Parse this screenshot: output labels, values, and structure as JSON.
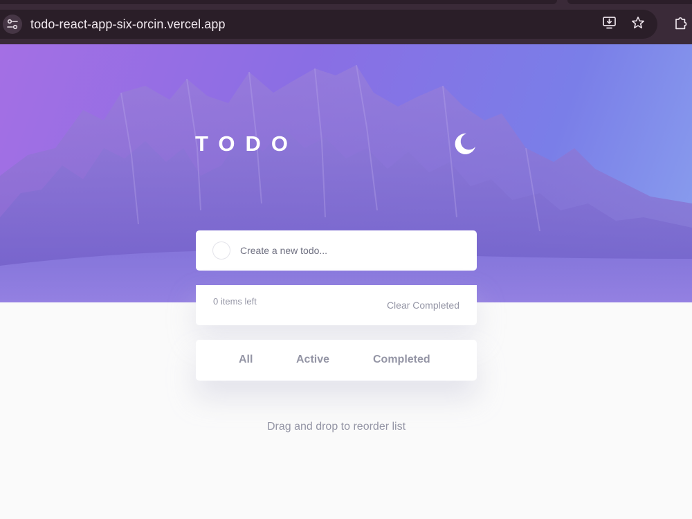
{
  "browser": {
    "url": "todo-react-app-six-orcin.vercel.app",
    "icons": [
      "site-settings-icon",
      "install-app-icon",
      "bookmark-star-icon",
      "extensions-icon"
    ]
  },
  "app": {
    "title": "TODO",
    "theme_toggle_icon": "moon-icon"
  },
  "new_todo": {
    "placeholder": "Create a new todo..."
  },
  "list_footer": {
    "items_left": "0 items left",
    "clear_label": "Clear Completed"
  },
  "filters": {
    "all": "All",
    "active": "Active",
    "completed": "Completed"
  },
  "hint": "Drag and drop to reorder list",
  "colors": {
    "hero_gradient_start": "#a46fe4",
    "hero_gradient_end": "#8aa0ee",
    "text_muted": "#9495a5",
    "card_bg": "#ffffff",
    "page_bg": "#fafafa"
  }
}
